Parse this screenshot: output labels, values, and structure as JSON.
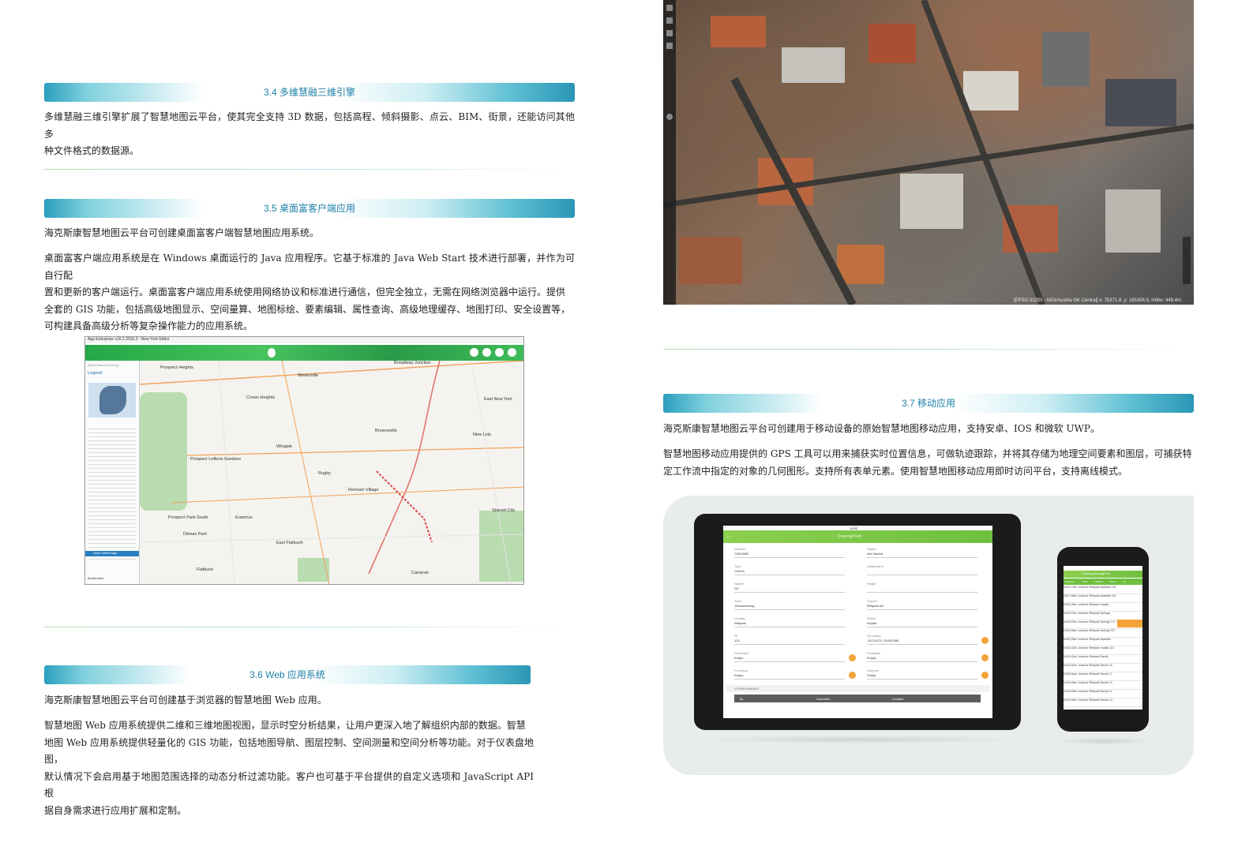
{
  "sections": {
    "s34": {
      "title": "3.4 多维慧融三维引擎",
      "para_lines": [
        "多维慧融三维引擎扩展了智慧地图云平台，使其完全支持 3D 数据，包括高程、倾斜摄影、点云、BIM、街景，还能访问其他多",
        "种文件格式的数据源。"
      ]
    },
    "s35": {
      "title": "3.5 桌面富客户端应用",
      "intro": "海克斯康智慧地图云平台可创建桌面富客户端智慧地图应用系统。",
      "para_lines": [
        "桌面富客户端应用系统是在 Windows 桌面运行的 Java 应用程序。它基于标准的 Java Web Start 技术进行部署，并作为可自行配",
        "置和更新的客户端运行。桌面富客户端应用系统使用网络协议和标准进行通信，但完全独立，无需在网络浏览器中运行。提供",
        "全套的 GIS 功能，包括高级地图显示、空间量算、地图标绘、要素编辑、属性查询、高级地理缓存、地图打印、安全设置等，",
        "可构建具备高级分析等复杂操作能力的应用系统。"
      ]
    },
    "s36": {
      "title": "3.6 Web 应用系统",
      "intro": "海克斯康智慧地图云平台可创建基于浏览器的智慧地图 Web 应用。",
      "para_lines": [
        "智慧地图 Web 应用系统提供二维和三维地图视图，显示时空分析结果，让用户更深入地了解组织内部的数据。智慧",
        "地图 Web 应用系统提供轻量化的 GIS 功能，包括地图导航、图层控制、空间测量和空间分析等功能。对于仪表盘地图，",
        "默认情况下会启用基于地图范围选择的动态分析过滤功能。客户也可基于平台提供的自定义选项和 JavaScript API 根",
        "据自身需求进行应用扩展和定制。"
      ]
    },
    "s37": {
      "title": "3.7 移动应用",
      "intro": "海克斯康智慧地图云平台可创建用于移动设备的原始智慧地图移动应用，支持安卓、IOS 和微软 UWP。",
      "para_lines": [
        "智慧地图移动应用提供的 GPS 工具可以用来捕获实时位置信息，可做轨迹跟踪，并将其存储为地理空间要素和图层，可捕获特",
        "定工作流中指定的对象的几何图形。支持所有表单元素。使用智慧地图移动应用即时访问平台，支持离线模式。"
      ]
    }
  },
  "aerial": {
    "coord_text": "[EPSG:31255 - MGI/Austria GK Central] x: 75371.8, y: 165356.9, Höhe: 448.4m"
  },
  "desktop_app": {
    "window_title": "App Enterprise v16.1.2016.2 - New York Editor",
    "panel_title": "Legend",
    "panel_items": [
      "Quick Search (Ctrl+Q)",
      "Legend",
      "Bookmarks",
      "Open Street Map"
    ],
    "map_labels": [
      "Prospect Heights",
      "Weeksville",
      "Broadway Junction",
      "Crown Heights",
      "East New York",
      "Brownsville",
      "New Lots",
      "Wingate",
      "Prospect Lefferts Gardens",
      "Rugby",
      "Remsen Village",
      "Prospect Park South",
      "Erasmus",
      "Starrett City",
      "Ditmas Park",
      "East Flatbush",
      "Flatbush",
      "Canarsie"
    ]
  },
  "tablet_app": {
    "title": "DrawingPoint",
    "status_time": "10:02",
    "fields_left": [
      {
        "label": "Number",
        "value": "79810985"
      },
      {
        "label": "Type",
        "value": "Church"
      },
      {
        "label": "Nature",
        "value": "DU"
      },
      {
        "label": "Town",
        "value": "Johannesburg"
      },
      {
        "label": "Locality",
        "value": "Rietpark"
      },
      {
        "label": "Nr",
        "value": "124"
      },
      {
        "label": "Panorama",
        "value": "Empty"
      },
      {
        "label": "Frontdoor",
        "value": "Empty"
      }
    ],
    "fields_right": [
      {
        "label": "Status",
        "value": "Not Started"
      },
      {
        "label": "Justification",
        "value": ""
      },
      {
        "label": "Height",
        "value": ""
      },
      {
        "label": "Suburb",
        "value": "Rietpark AH"
      },
      {
        "label": "Street",
        "value": "Impala"
      },
      {
        "label": "Geometry",
        "value": "-26.21479 / 28.002086"
      },
      {
        "label": "Frontgate",
        "value": "Empty"
      },
      {
        "label": "Address",
        "value": "Empty"
      }
    ],
    "other_images_label": "OTHER IMAGES",
    "table_headers": [
      "Tip",
      "Comment",
      "Created"
    ]
  },
  "phone_app": {
    "title": "Drawing DrawingPoint",
    "headers": [
      "Distance",
      "Town",
      "Suburb",
      "Street",
      "Nr"
    ],
    "rows": [
      "5440,17km  Johanne  Rietpark  Alpetiale  101",
      "5337,95km  Johanne  Rietpark  Alpetiale  110",
      "5440,19km  Johanne  Rietpark  Impala",
      "5440,37km  Johanne  Rietpark  Springb",
      "5440,37km  Johanne  Rietpark  Springb  172",
      "5440,39km  Johanne  Rietpark  Springb  327",
      "5440,39km  Johanne  Rietpark  Alpetiale",
      "5440,41km  Johanne  Rietpark  Impala  110",
      "5440,41km  Johanne  Rietpark  Rands",
      "5440,41km  Johanne  Rietpark  Rands  15",
      "5440,41km  Johanne  Rietpark  Rands  17",
      "5440,43km  Johanne  Rietpark  Rands  10",
      "5440,43km  Johanne  Rietpark  Rands  11",
      "5440,43km  Johanne  Rietpark  Rands  13"
    ]
  }
}
